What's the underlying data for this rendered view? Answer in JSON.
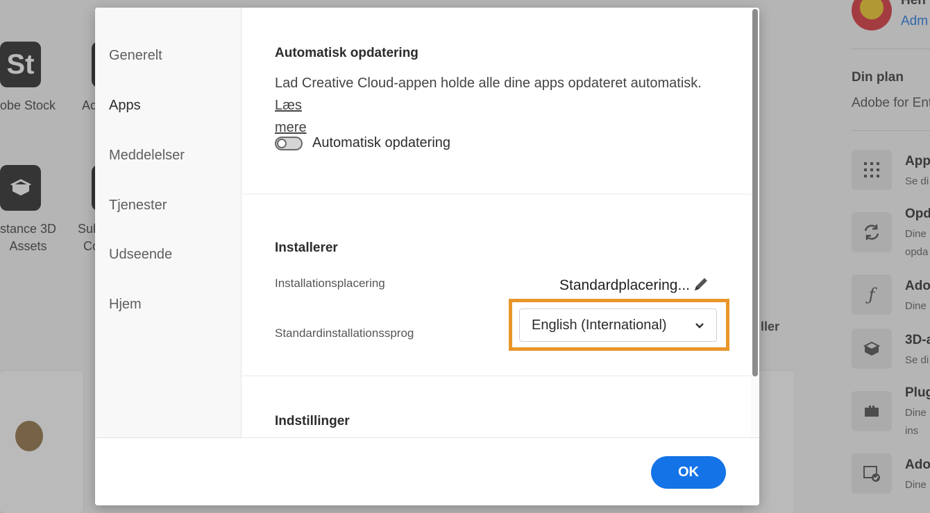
{
  "background": {
    "apps": [
      {
        "icon_text": "St",
        "label": "obe Stock"
      },
      {
        "icon_text": "",
        "label": "Ac"
      },
      {
        "icon_text": "",
        "label_line1": "stance 3D",
        "label_line2": "Assets"
      },
      {
        "icon_text": "",
        "label_line1": "Sub",
        "label_line2": "Co"
      }
    ],
    "right_panel": {
      "user_initial": "Adm",
      "user_name": "Hen",
      "plan_title": "Din plan",
      "plan_value": "Adobe for Ent",
      "items": [
        {
          "icon": "grid-icon",
          "title": "App",
          "sub": "Se di"
        },
        {
          "icon": "sync-icon",
          "title": "Opd",
          "sub": "Dine",
          "sub2": "opda"
        },
        {
          "icon": "font-icon",
          "title": "Ado",
          "sub": "Dine"
        },
        {
          "icon": "cube-icon",
          "title": "3D-a",
          "sub": "Se di"
        },
        {
          "icon": "plugin-icon",
          "title": "Plug",
          "sub": "Dine",
          "sub2": "ins"
        },
        {
          "icon": "portfolio-icon",
          "title": "Ado",
          "sub": "Dine"
        }
      ]
    },
    "partial_label": "ller"
  },
  "dialog": {
    "nav": [
      {
        "label": "Generelt"
      },
      {
        "label": "Apps"
      },
      {
        "label": "Meddelelser"
      },
      {
        "label": "Tjenester"
      },
      {
        "label": "Udseende"
      },
      {
        "label": "Hjem"
      }
    ],
    "active_nav": "Apps",
    "auto_update": {
      "title": "Automatisk opdatering",
      "description": "Lad Creative Cloud-appen holde alle dine apps opdateret automatisk.",
      "learn_more": "Læs mere",
      "learn_more_line1": "Læs",
      "learn_more_line2": "mere",
      "toggle_label": "Automatisk opdatering",
      "toggle_on": false
    },
    "installer": {
      "title": "Installerer",
      "location_label": "Installationsplacering",
      "location_value": "Standardplacering...",
      "language_label": "Standardinstallationssprog",
      "language_value": "English (International)"
    },
    "settings": {
      "title": "Indstillinger"
    },
    "ok_label": "OK"
  },
  "colors": {
    "accent": "#1473e6",
    "highlight": "#e8962a"
  }
}
